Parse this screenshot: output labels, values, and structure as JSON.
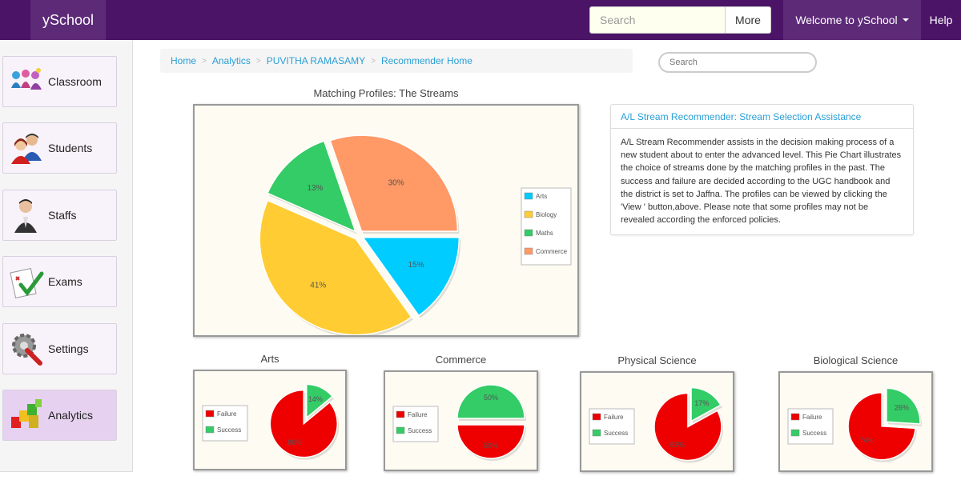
{
  "nav": {
    "brand": "ySchool",
    "search_placeholder": "Search",
    "more_label": "More",
    "welcome_label": "Welcome to ySchool",
    "help_label": "Help"
  },
  "sidebar": {
    "items": [
      {
        "label": "Classroom",
        "icon": "classroom-icon"
      },
      {
        "label": "Students",
        "icon": "students-icon"
      },
      {
        "label": "Staffs",
        "icon": "staffs-icon"
      },
      {
        "label": "Exams",
        "icon": "exams-icon"
      },
      {
        "label": "Settings",
        "icon": "settings-icon"
      },
      {
        "label": "Analytics",
        "icon": "analytics-icon",
        "active": true
      }
    ]
  },
  "breadcrumb": [
    "Home",
    "Analytics",
    "PUVITHA RAMASAMY",
    "Recommender Home"
  ],
  "content_search_placeholder": "Search",
  "info": {
    "title": "A/L Stream Recommender: Stream Selection Assistance",
    "body": "A/L Stream Recommender assists in the decision making process of a new student about to enter the advanced level. This Pie Chart illustrates the choice of streams done by the matching profiles in the past. The success and failure are decided according to the UGC handbook and the district is set to Jaffna. The profiles can be viewed by clicking the 'View ' button,above. Please note that some profiles may not be revealed according the enforced policies."
  },
  "colors": {
    "Arts": "#00ccff",
    "Biology": "#ffcc33",
    "Maths": "#33cc66",
    "Commerce": "#ff9966",
    "Failure": "#ee0000",
    "Success": "#33cc66"
  },
  "chart_data": [
    {
      "type": "pie",
      "title": "Matching Profiles: The Streams",
      "categories": [
        "Arts",
        "Biology",
        "Maths",
        "Commerce"
      ],
      "values": [
        15,
        41,
        13,
        30
      ],
      "labels": [
        "15%",
        "41%",
        "13%",
        "30%"
      ],
      "legend": "right"
    },
    {
      "type": "pie",
      "title": "Arts",
      "categories": [
        "Failure",
        "Success"
      ],
      "values": [
        86,
        14
      ],
      "labels": [
        "86%",
        "14%"
      ],
      "legend": "left"
    },
    {
      "type": "pie",
      "title": "Commerce",
      "categories": [
        "Failure",
        "Success"
      ],
      "values": [
        50,
        50
      ],
      "labels": [
        "50%",
        "50%"
      ],
      "legend": "left"
    },
    {
      "type": "pie",
      "title": "Physical Science",
      "categories": [
        "Failure",
        "Success"
      ],
      "values": [
        83,
        17
      ],
      "labels": [
        "83%",
        "17%"
      ],
      "legend": "left"
    },
    {
      "type": "pie",
      "title": "Biological Science",
      "categories": [
        "Failure",
        "Success"
      ],
      "values": [
        74,
        26
      ],
      "labels": [
        "74%",
        "26%"
      ],
      "legend": "left"
    }
  ]
}
